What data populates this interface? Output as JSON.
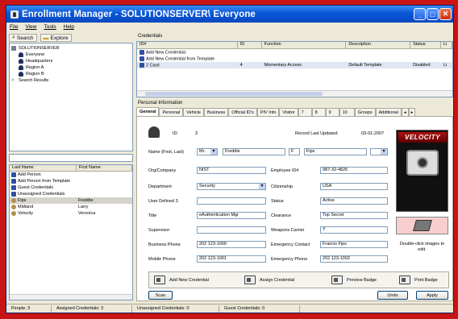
{
  "window": {
    "title": "Enrollment Manager - SOLUTIONSERVER\\ Everyone"
  },
  "menu": [
    "File",
    "View",
    "Tools",
    "Help"
  ],
  "left": {
    "tabs": [
      "Search",
      "Explore"
    ],
    "tree": [
      {
        "label": "SOLUTIONSERVER",
        "icon": "server-icon"
      },
      {
        "label": "Everyone",
        "icon": "group-icon"
      },
      {
        "label": "Headquarters",
        "icon": "group-icon"
      },
      {
        "label": "Region A",
        "icon": "group-icon"
      },
      {
        "label": "Region B",
        "icon": "group-icon"
      },
      {
        "label": "Search Results",
        "icon": "search-icon"
      }
    ],
    "grid_headers": [
      "Last Name",
      "First Name"
    ],
    "rows": [
      {
        "last": "Add Person",
        "first": ""
      },
      {
        "last": "Add Person from Template",
        "first": ""
      },
      {
        "last": "Guest Credentials",
        "first": ""
      },
      {
        "last": "Unassigned Credentials",
        "first": ""
      },
      {
        "last": "Fips",
        "first": "Freddie"
      },
      {
        "last": "Midland",
        "first": "Larry"
      },
      {
        "last": "Velocity",
        "first": "Veronica"
      }
    ]
  },
  "credentials": {
    "label": "Credentials",
    "headers": [
      "ID#",
      "ID",
      "Function",
      "Description",
      "Status",
      "Li"
    ],
    "rows": [
      {
        "c1": "Add New Credential",
        "c2": "",
        "c3": "",
        "c4": "",
        "c5": "",
        "c6": ""
      },
      {
        "c1": "Add New Credential from Template",
        "c2": "",
        "c3": "",
        "c4": "",
        "c5": "",
        "c6": ""
      },
      {
        "c1": "2 Card",
        "c2": "4",
        "c3": "Momentary Access",
        "c4": "Default Template",
        "c5": "Disabled",
        "c6": "Li"
      }
    ]
  },
  "personal": {
    "label": "Personal Information",
    "tabs": [
      "General",
      "Personal",
      "Vehicle",
      "Business",
      "Official ID's",
      "PIV Info",
      "Visitor",
      "7",
      "8",
      "9",
      "10",
      "Groups",
      "Additional"
    ],
    "id_label": "ID:",
    "id_value": "3",
    "record_label": "Record Last Updated:",
    "record_value": "03-01-2007",
    "name_label": "Name (First, Last)",
    "name_prefix": "Mr.",
    "first_name": "Freddie",
    "middle": "F",
    "last_name": "Fips",
    "fields_left": [
      {
        "label": "Org/Company",
        "value": "NIST"
      },
      {
        "label": "Department",
        "value": "Security"
      },
      {
        "label": "User Defined 3",
        "value": ""
      },
      {
        "label": "Title",
        "value": "eAuthentication Mgr"
      },
      {
        "label": "Supervisor",
        "value": ""
      },
      {
        "label": "Business Phone",
        "value": "202 123-1000"
      },
      {
        "label": "Mobile Phone",
        "value": "202 123-1001"
      }
    ],
    "fields_right": [
      {
        "label": "Employee ID#",
        "value": "987-32-4826"
      },
      {
        "label": "Citizenship",
        "value": "USA"
      },
      {
        "label": "Status",
        "value": "Active"
      },
      {
        "label": "Clearance",
        "value": "Top Secret"
      },
      {
        "label": "Weapons Carrier",
        "value": "Y"
      },
      {
        "label": "Emergency Contact",
        "value": "Francis Fips"
      },
      {
        "label": "Emergency Phone",
        "value": "202 123-1002"
      }
    ],
    "photo_logo": "VELOCITY",
    "double_click": "Double-click images to edit.",
    "actions": [
      "Add New Credential",
      "Assign Credential",
      "Preview Badge",
      "Print Badge"
    ],
    "scan": "Scan",
    "undo": "Undo",
    "apply": "Apply"
  },
  "status": [
    "People: 3",
    "Assigned Credentials: 3",
    "Unassigned Credentials: 0",
    "Guest Credentials: 0"
  ]
}
